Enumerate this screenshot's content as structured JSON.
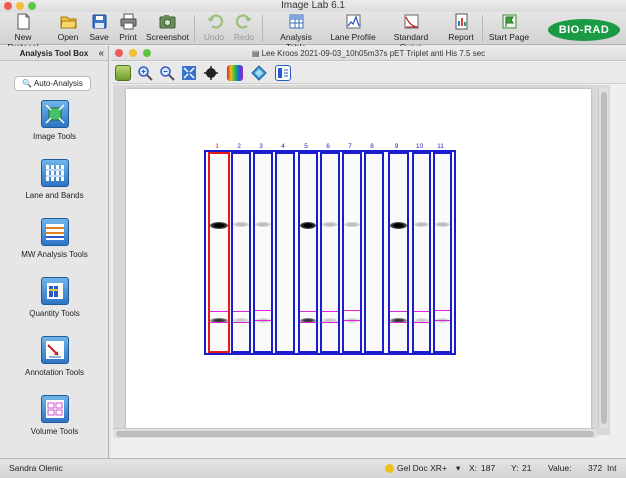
{
  "app": {
    "title": "Image Lab 6.1"
  },
  "toolbar": {
    "buttons": [
      {
        "label": "New Protocol",
        "icon": "new-protocol-icon",
        "enabled": true
      },
      {
        "label": "Open",
        "icon": "folder-icon",
        "enabled": true
      },
      {
        "label": "Save",
        "icon": "save-icon",
        "enabled": true
      },
      {
        "label": "Print",
        "icon": "print-icon",
        "enabled": true
      },
      {
        "label": "Screenshot",
        "icon": "camera-icon",
        "enabled": true
      },
      {
        "label": "Undo",
        "icon": "undo-icon",
        "enabled": false
      },
      {
        "label": "Redo",
        "icon": "redo-icon",
        "enabled": false
      },
      {
        "label": "Analysis Table",
        "icon": "table-icon",
        "enabled": true
      },
      {
        "label": "Lane Profile",
        "icon": "lane-profile-icon",
        "enabled": true
      },
      {
        "label": "Standard Curve",
        "icon": "standard-curve-icon",
        "enabled": true
      },
      {
        "label": "Report",
        "icon": "report-icon",
        "enabled": true
      },
      {
        "label": "Start Page",
        "icon": "start-page-icon",
        "enabled": true
      }
    ],
    "logo": "BIO-RAD",
    "logo_color": "#1a9a45"
  },
  "toolbox": {
    "title": "Analysis Tool Box",
    "auto_analysis": "Auto-Analysis",
    "tools": [
      {
        "label": "Image Tools",
        "icon": "image-tools-icon"
      },
      {
        "label": "Lane and Bands",
        "icon": "lane-and-bands-icon"
      },
      {
        "label": "MW Analysis Tools",
        "icon": "mw-analysis-icon"
      },
      {
        "label": "Quantity Tools",
        "icon": "quantity-tools-icon"
      },
      {
        "label": "Annotation Tools",
        "icon": "annotation-tools-icon"
      },
      {
        "label": "Volume Tools",
        "icon": "volume-tools-icon"
      }
    ]
  },
  "document": {
    "title": "Lee Kroos 2021-09-03_10h05m37s pET Triplet anti His 7.5 sec",
    "lanes": [
      "1",
      "2",
      "3",
      "4",
      "5",
      "6",
      "7",
      "8",
      "9",
      "10",
      "11"
    ],
    "selected_lane": "1",
    "lane_color": "#1d1dd0",
    "selected_lane_color": "#e81919",
    "band_marker_color": "#e020e0"
  },
  "status": {
    "user": "Sandra Olenic",
    "instrument": "Gel Doc XR+",
    "x_label": "X:",
    "x_value": "187",
    "y_label": "Y:",
    "y_value": "21",
    "value_label": "Value:",
    "value": "372",
    "unit": "Int"
  }
}
